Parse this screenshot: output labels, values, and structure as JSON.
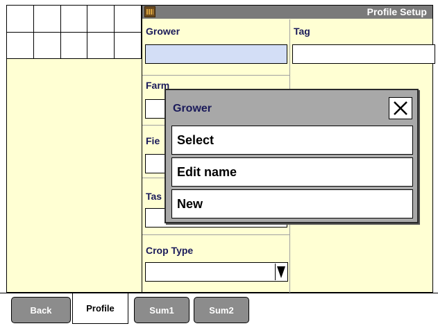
{
  "title_bar": {
    "title": "Profile Setup",
    "icon": "app-icon"
  },
  "form": {
    "grower_label": "Grower",
    "grower_value": "",
    "tag_label": "Tag",
    "tag_value": "",
    "farm_label": "Farm",
    "field_label": "Fie",
    "task_label": "Tas",
    "crop_type_label": "Crop Type",
    "crop_type_value": ""
  },
  "dialog": {
    "title": "Grower",
    "close_icon": "close-icon",
    "options": [
      "Select",
      "Edit name",
      "New"
    ]
  },
  "tabs": [
    "Back",
    "Profile",
    "Sum1",
    "Sum2"
  ],
  "colors": {
    "panel_background": "#ffffd3",
    "title_bar": "#7a7a7a",
    "selected_field": "#d3def6",
    "dialog_background": "#a8a8a8",
    "tab_inactive": "#8c8c8c"
  }
}
